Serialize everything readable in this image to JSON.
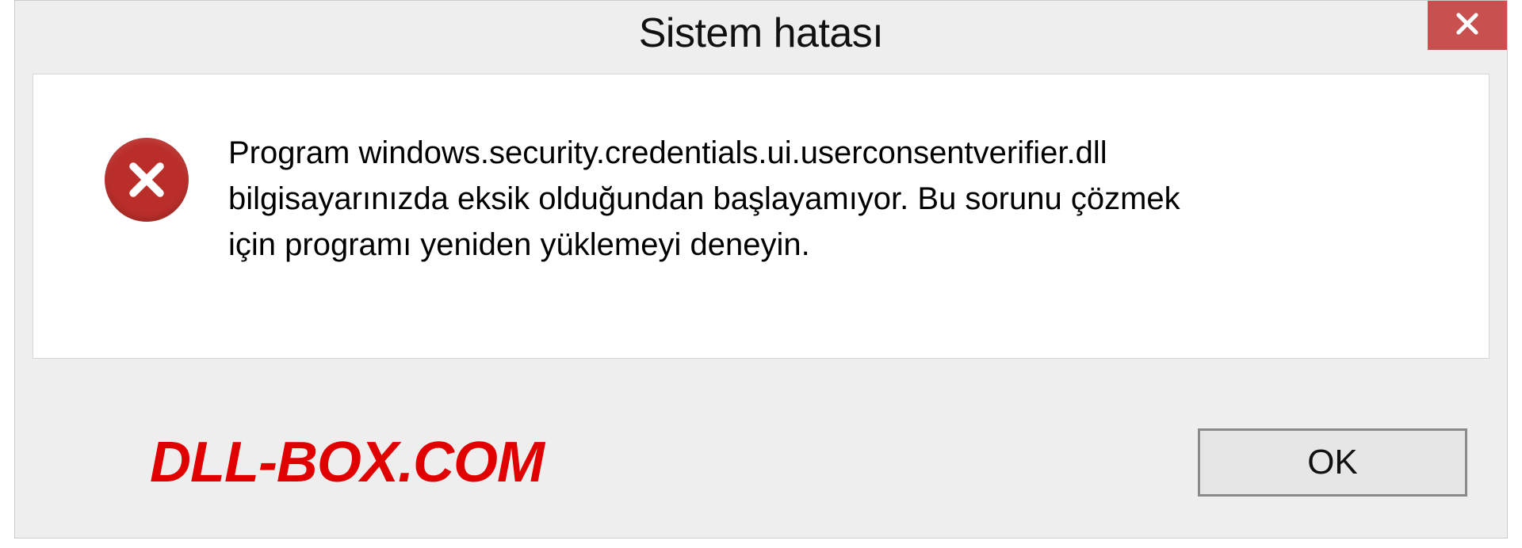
{
  "dialog": {
    "title": "Sistem hatası",
    "message": "Program windows.security.credentials.ui.userconsentverifier.dll bilgisayarınızda eksik olduğundan başlayamıyor. Bu sorunu çözmek için programı yeniden yüklemeyi deneyin.",
    "ok_label": "OK",
    "watermark": "DLL-BOX.COM"
  }
}
